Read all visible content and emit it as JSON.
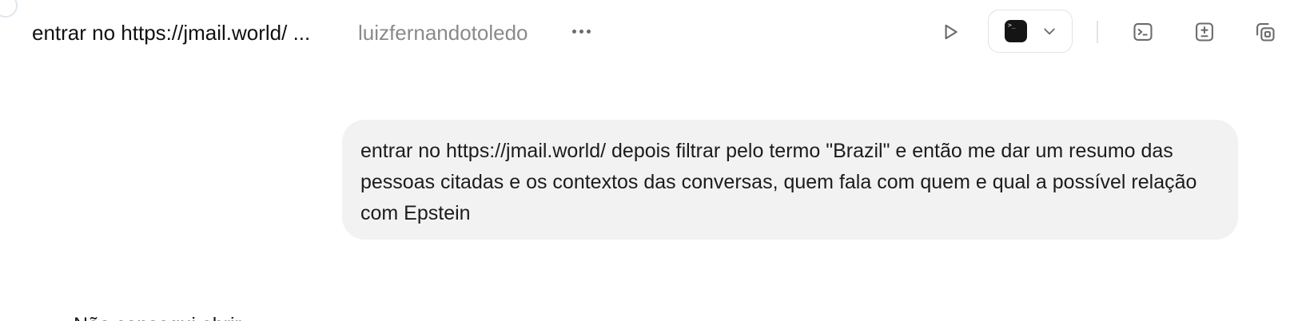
{
  "header": {
    "title": "entrar no https://jmail.world/ ...",
    "project": "luizfernandotoledo",
    "icons": {
      "more": "more-horizontal-icon",
      "run": "play-icon",
      "terminal": "terminal-app-icon",
      "dropdown": "chevron-down-icon",
      "console": "terminal-prompt-icon",
      "diff": "plus-minus-icon",
      "copy": "copy-window-icon"
    }
  },
  "message": {
    "text": "entrar no https://jmail.world/ depois filtrar pelo termo \"Brazil\" e então me dar um resumo das pessoas citadas e os contextos das conversas, quem fala com quem e qual a possível relação com Epstein"
  },
  "response": {
    "partial_text": "Não consegui abrir ..."
  },
  "colors": {
    "bubble_bg": "#f2f2f2",
    "muted_text": "#8a8a8a",
    "icon": "#6b6b6b"
  }
}
